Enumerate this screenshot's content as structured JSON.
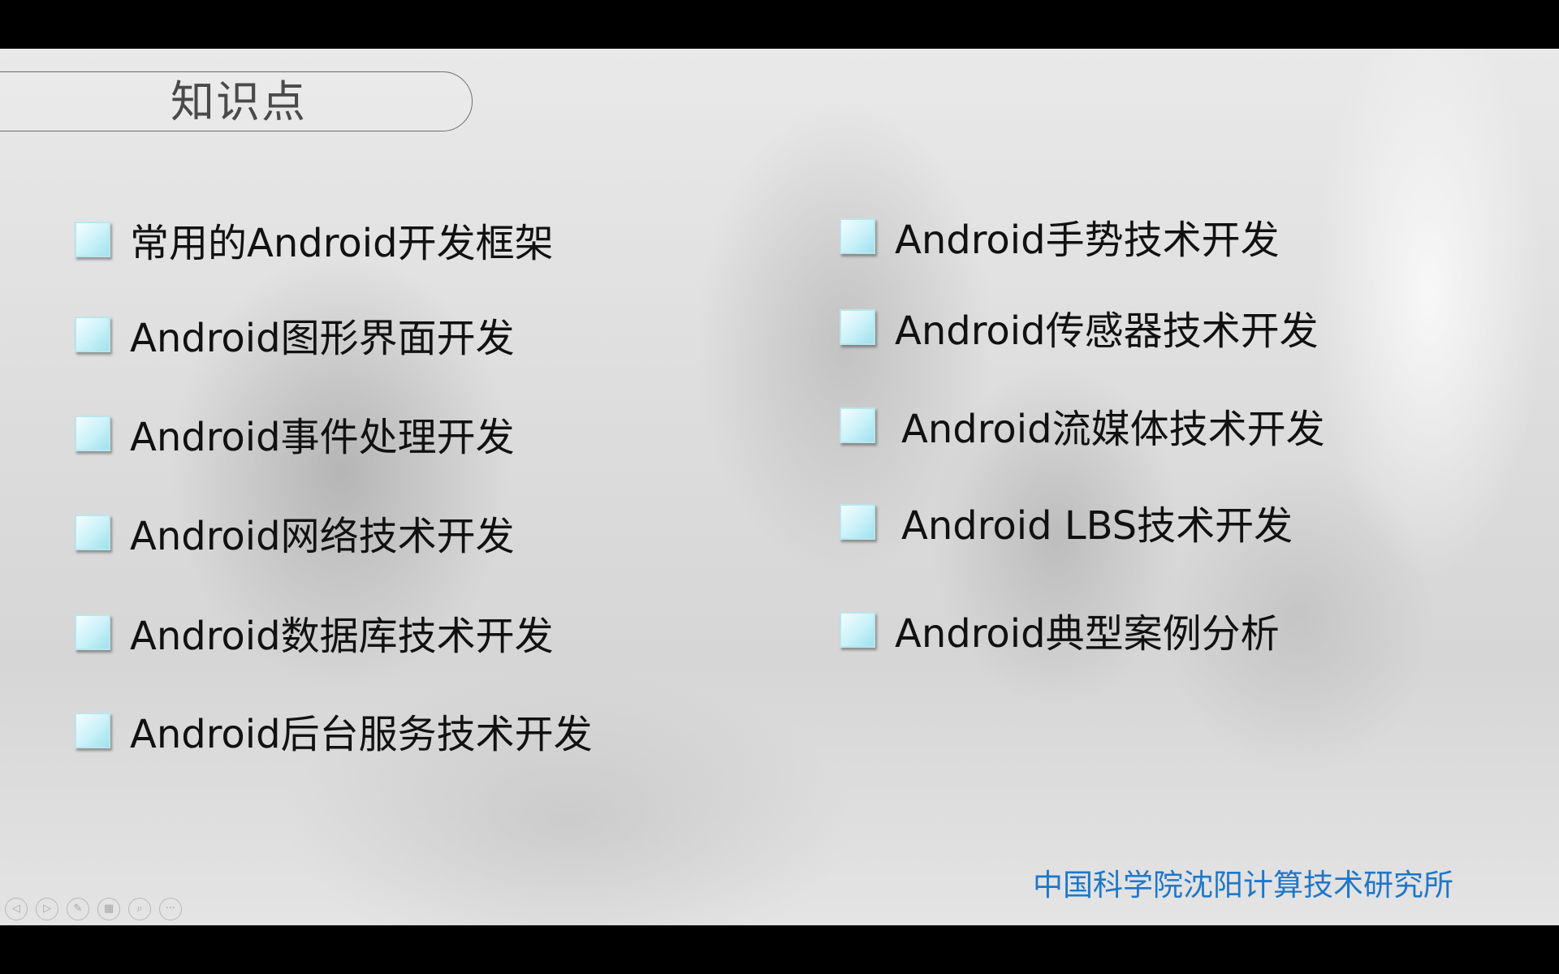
{
  "slide": {
    "title": "知识点",
    "left_items": [
      {
        "label": "常用的Android开发框架"
      },
      {
        "label": "Android图形界面开发"
      },
      {
        "label": "Android事件处理开发"
      },
      {
        "label": "Android网络技术开发"
      },
      {
        "label": "Android数据库技术开发"
      },
      {
        "label": "Android后台服务技术开发"
      }
    ],
    "right_items": [
      {
        "label": "Android手势技术开发"
      },
      {
        "label": "Android传感器技术开发"
      },
      {
        "label": "Android流媒体技术开发"
      },
      {
        "label": "Android LBS技术开发"
      },
      {
        "label": "Android典型案例分析"
      }
    ],
    "footer": "中国科学院沈阳计算技术研究所",
    "accent_color": "#1f77c9"
  },
  "controls": [
    {
      "name": "prev-slide-icon",
      "glyph": "◁"
    },
    {
      "name": "next-slide-icon",
      "glyph": "▷"
    },
    {
      "name": "pen-icon",
      "glyph": "✎"
    },
    {
      "name": "slides-grid-icon",
      "glyph": "▦"
    },
    {
      "name": "zoom-icon",
      "glyph": "⌕"
    },
    {
      "name": "more-options-icon",
      "glyph": "···"
    }
  ]
}
